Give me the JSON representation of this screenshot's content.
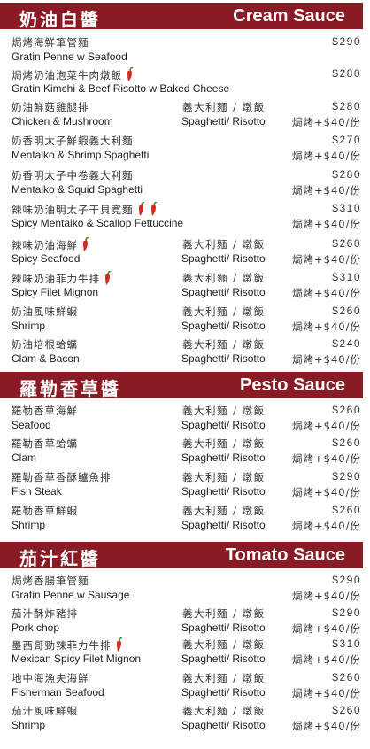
{
  "sections": [
    {
      "zh": "奶油白醬",
      "en": "Cream Sauce",
      "items": [
        {
          "zh": "焗烤海鮮筆管麵",
          "en": "Gratin Penne w Seafood",
          "opt_zh": "",
          "opt_en": "",
          "price": "$290",
          "addon": "",
          "spicy": 0
        },
        {
          "zh": "焗烤奶油泡菜牛肉燉飯",
          "en": "Gratin Kimchi & Beef Risotto w Baked Cheese",
          "opt_zh": "",
          "opt_en": "",
          "price": "$280",
          "addon": "",
          "spicy": 1
        },
        {
          "zh": "奶油鮮菇雞腿排",
          "en": "Chicken & Mushroom",
          "opt_zh": "義大利麵 / 燉飯",
          "opt_en": "Spaghetti/ Risotto",
          "price": "$280",
          "addon": "焗烤+$40/份",
          "spicy": 0
        },
        {
          "zh": "奶香明太子鮮蝦義大利麵",
          "en": "Mentaiko & Shrimp Spaghetti",
          "opt_zh": "",
          "opt_en": "",
          "price": "$270",
          "addon": "焗烤+$40/份",
          "spicy": 0
        },
        {
          "zh": "奶香明太子中卷義大利麵",
          "en": "Mentaiko & Squid Spaghetti",
          "opt_zh": "",
          "opt_en": "",
          "price": "$280",
          "addon": "焗烤+$40/份",
          "spicy": 0
        },
        {
          "zh": "辣味奶油明太子干貝寬麵",
          "en": "Spicy Mentaiko & Scallop Fettuccine",
          "opt_zh": "",
          "opt_en": "",
          "price": "$310",
          "addon": "焗烤+$40/份",
          "spicy": 2
        },
        {
          "zh": "辣味奶油海鮮",
          "en": "Spicy Seafood",
          "opt_zh": "義大利麵 / 燉飯",
          "opt_en": "Spaghetti/ Risotto",
          "price": "$260",
          "addon": "焗烤+$40/份",
          "spicy": 1
        },
        {
          "zh": "辣味奶油菲力牛排",
          "en": "Spicy Filet Mignon",
          "opt_zh": "義大利麵 / 燉飯",
          "opt_en": "Spaghetti/ Risotto",
          "price": "$310",
          "addon": "焗烤+$40/份",
          "spicy": 1
        },
        {
          "zh": "奶油風味鮮蝦",
          "en": "Shrimp",
          "opt_zh": "義大利麵 / 燉飯",
          "opt_en": "Spaghetti/ Risotto",
          "price": "$260",
          "addon": "焗烤+$40/份",
          "spicy": 0
        },
        {
          "zh": "奶油培根蛤蠣",
          "en": "Clam & Bacon",
          "opt_zh": "義大利麵 / 燉飯",
          "opt_en": "Spaghetti/ Risotto",
          "price": "$240",
          "addon": "焗烤+$40/份",
          "spicy": 0
        }
      ]
    },
    {
      "zh": "羅勒香草醬",
      "en": "Pesto Sauce",
      "items": [
        {
          "zh": "羅勒香草海鮮",
          "en": "Seafood",
          "opt_zh": "義大利麵 / 燉飯",
          "opt_en": "Spaghetti/ Risotto",
          "price": "$260",
          "addon": "焗烤+$40/份",
          "spicy": 0
        },
        {
          "zh": "羅勒香草蛤蠣",
          "en": "Clam",
          "opt_zh": "義大利麵 / 燉飯",
          "opt_en": "Spaghetti/ Risotto",
          "price": "$260",
          "addon": "焗烤+$40/份",
          "spicy": 0
        },
        {
          "zh": "羅勒香草香酥鱸魚排",
          "en": "Fish Steak",
          "opt_zh": "義大利麵 / 燉飯",
          "opt_en": "Spaghetti/ Risotto",
          "price": "$290",
          "addon": "焗烤+$40/份",
          "spicy": 0
        },
        {
          "zh": "羅勒香草鮮蝦",
          "en": "Shrimp",
          "opt_zh": "義大利麵 / 燉飯",
          "opt_en": "Spaghetti/ Risotto",
          "price": "$260",
          "addon": "焗烤+$40/份",
          "spicy": 0
        }
      ]
    },
    {
      "zh": "茄汁紅醬",
      "en": "Tomato Sauce",
      "items": [
        {
          "zh": "焗烤香腸筆管麵",
          "en": "Gratin Penne w Sausage",
          "opt_zh": "",
          "opt_en": "",
          "price": "$290",
          "addon": "焗烤+$40/份",
          "spicy": 0
        },
        {
          "zh": "茄汁酥炸豬排",
          "en": "Pork chop",
          "opt_zh": "義大利麵 / 燉飯",
          "opt_en": "Spaghetti/ Risotto",
          "price": "$290",
          "addon": "焗烤+$40/份",
          "spicy": 0
        },
        {
          "zh": "墨西哥勁辣菲力牛排",
          "en": "Mexican Spicy Filet Mignon",
          "opt_zh": "義大利麵 / 燉飯",
          "opt_en": "Spaghetti/ Risotto",
          "price": "$310",
          "addon": "焗烤+$40/份",
          "spicy": 1
        },
        {
          "zh": "地中海漁夫海鮮",
          "en": "Fisherman Seafood",
          "opt_zh": "義大利麵 / 燉飯",
          "opt_en": "Spaghetti/ Risotto",
          "price": "$260",
          "addon": "焗烤+$40/份",
          "spicy": 0
        },
        {
          "zh": "茄汁風味鮮蝦",
          "en": "Shrimp",
          "opt_zh": "義大利麵 / 燉飯",
          "opt_en": "Spaghetti/ Risotto",
          "price": "$260",
          "addon": "焗烤+$40/份",
          "spicy": 0
        }
      ]
    }
  ],
  "colors": {
    "accent": "#8a1b24",
    "pepper_red": "#d22a1e",
    "pepper_green": "#3f8f2a"
  }
}
